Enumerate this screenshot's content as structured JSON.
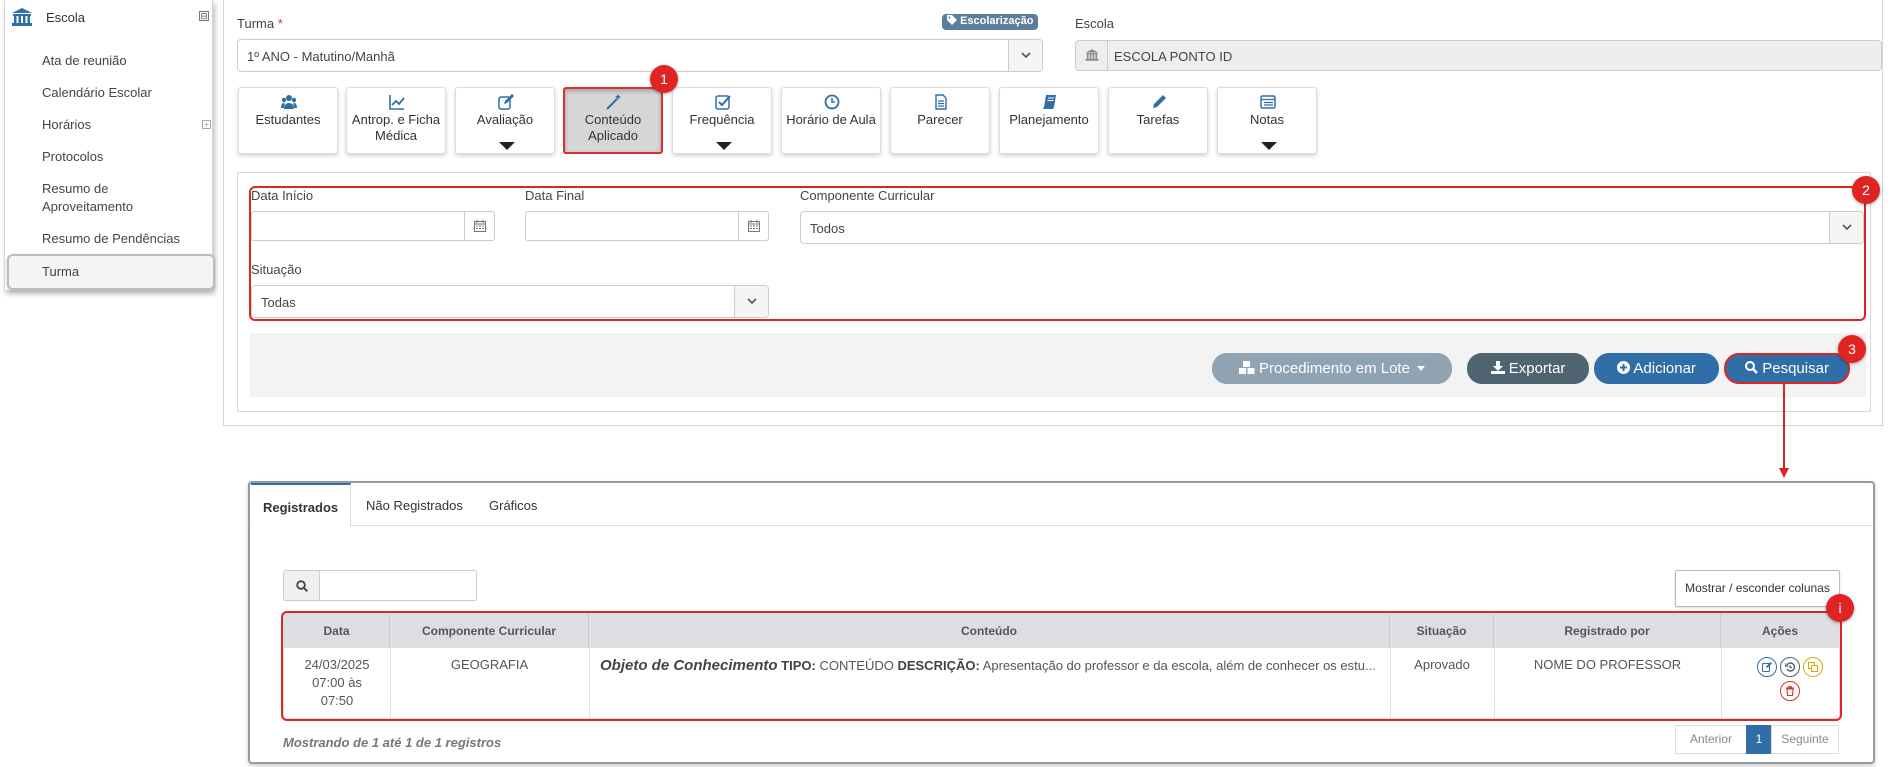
{
  "sidebar": {
    "header": "Escola",
    "toggle": "⊟",
    "items": [
      {
        "label": "Ata de reunião"
      },
      {
        "label": "Calendário Escolar"
      },
      {
        "label": "Horários"
      },
      {
        "label": "Protocolos"
      },
      {
        "label": "Resumo de Aproveitamento"
      },
      {
        "label": "Resumo de Pendências"
      },
      {
        "label": "Turma"
      }
    ]
  },
  "form": {
    "turma_label": "Turma",
    "required_mark": "*",
    "tag": "Escolarização",
    "turma_value": "1º ANO - Matutino/Manhã",
    "escola_label": "Escola",
    "escola_value": "ESCOLA PONTO ID"
  },
  "toolbar": [
    {
      "label": "Estudantes",
      "icon": "users-icon"
    },
    {
      "label": "Antrop. e Ficha Médica",
      "icon": "line-chart-icon"
    },
    {
      "label": "Avaliação",
      "icon": "edit-icon",
      "dropdown": true
    },
    {
      "label": "Conteúdo Aplicado",
      "icon": "magic-wand-icon",
      "active": true
    },
    {
      "label": "Frequência",
      "icon": "check-square-icon",
      "dropdown": true
    },
    {
      "label": "Horário de Aula",
      "icon": "clock-icon"
    },
    {
      "label": "Parecer",
      "icon": "file-icon"
    },
    {
      "label": "Planejamento",
      "icon": "book-icon"
    },
    {
      "label": "Tarefas",
      "icon": "pencil-icon"
    },
    {
      "label": "Notas",
      "icon": "list-icon",
      "dropdown": true
    }
  ],
  "markers": {
    "m1": "1",
    "m2": "2",
    "m3": "3",
    "mi": "i"
  },
  "filters": {
    "data_inicio_label": "Data Início",
    "data_final_label": "Data Final",
    "componente_label": "Componente Curricular",
    "componente_value": "Todos",
    "situacao_label": "Situação",
    "situacao_value": "Todas"
  },
  "actions": {
    "lote": "Procedimento em Lote",
    "exportar": "Exportar",
    "adicionar": "Adicionar",
    "pesquisar": "Pesquisar"
  },
  "colors": {
    "accent": "#2f6ea7",
    "marker": "#e02424",
    "exportar": "#4e6470",
    "lote": "#8fa3b3"
  },
  "results": {
    "tabs": [
      "Registrados",
      "Não Registrados",
      "Gráficos"
    ],
    "columns_button": "Mostrar / esconder colunas",
    "headers": [
      "Data",
      "Componente Curricular",
      "Conteúdo",
      "Situação",
      "Registrado por",
      "Ações"
    ],
    "row": {
      "date_line1": "24/03/2025",
      "date_line2": "07:00 às",
      "date_line3": "07:50",
      "componente": "GEOGRAFIA",
      "conteudo_title": "Objeto de Conhecimento",
      "tipo_label": "TIPO:",
      "tipo_value": "CONTEÚDO",
      "descricao_label": "DESCRIÇÃO:",
      "descricao_value": "Apresentação do professor e da escola, além de conhecer os estu...",
      "situacao": "Aprovado",
      "registrado_por": "NOME DO PROFESSOR"
    },
    "summary": "Mostrando de 1 até 1 de 1 registros",
    "pagination": {
      "prev": "Anterior",
      "page": "1",
      "next": "Seguinte"
    }
  }
}
